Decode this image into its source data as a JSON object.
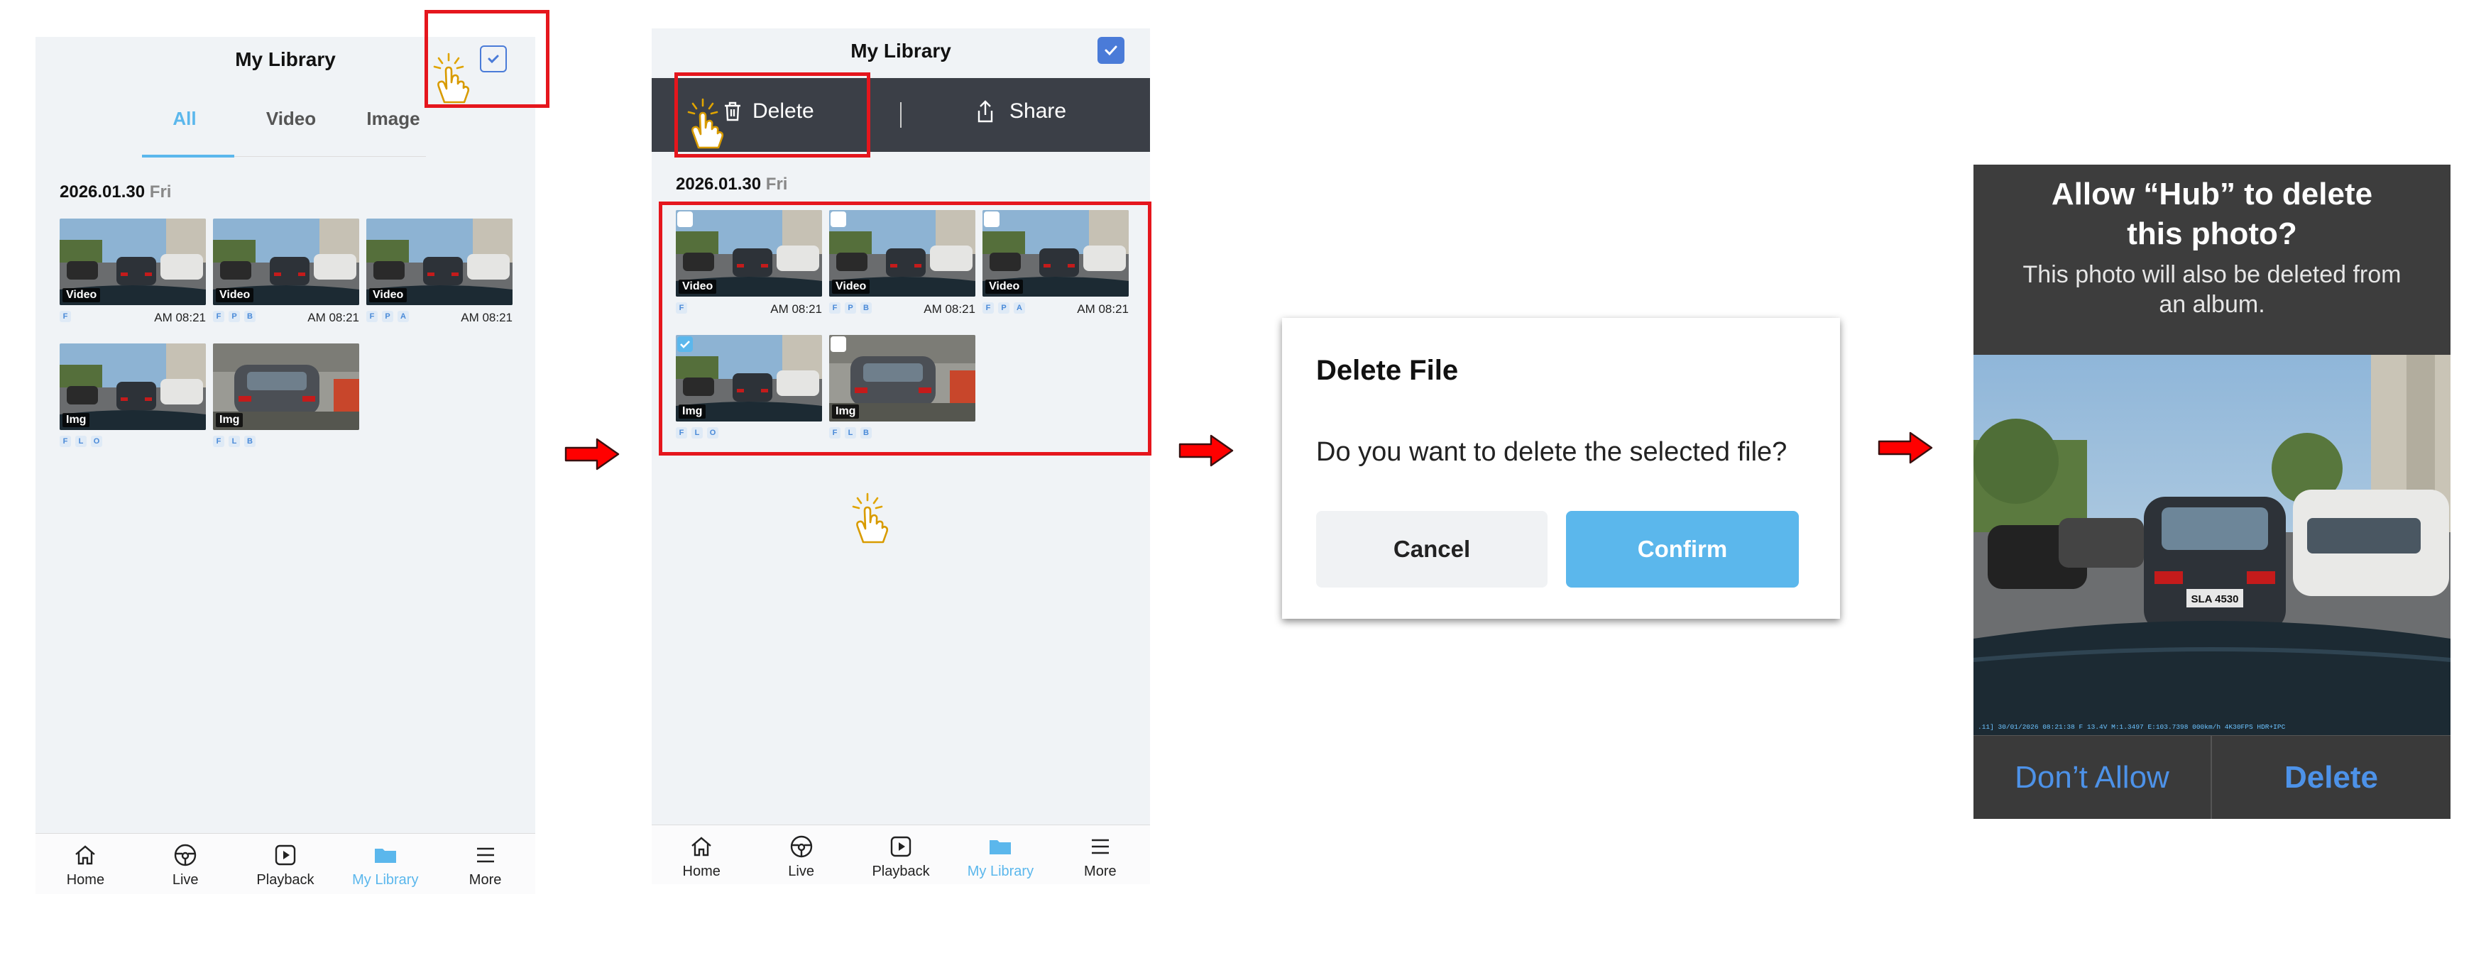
{
  "screen1": {
    "title": "My Library",
    "tabs": [
      {
        "label": "All",
        "active": true
      },
      {
        "label": "Video",
        "active": false
      },
      {
        "label": "Image",
        "active": false
      }
    ],
    "date": "2026.01.30",
    "weekday": "Fri",
    "files": [
      {
        "tag": "Video",
        "badges": [
          "F"
        ],
        "time": "AM 08:21"
      },
      {
        "tag": "Video",
        "badges": [
          "F",
          "P",
          "B"
        ],
        "time": "AM 08:21"
      },
      {
        "tag": "Video",
        "badges": [
          "F",
          "P",
          "A"
        ],
        "time": "AM 08:21"
      },
      {
        "tag": "Img",
        "badges": [
          "F",
          "L",
          "O"
        ],
        "time": ""
      },
      {
        "tag": "Img",
        "badges": [
          "F",
          "L",
          "B"
        ],
        "time": ""
      }
    ]
  },
  "screen2": {
    "title": "My Library",
    "delete_label": "Delete",
    "share_label": "Share",
    "date": "2026.01.30",
    "weekday": "Fri",
    "files": [
      {
        "tag": "Video",
        "badges": [
          "F"
        ],
        "time": "AM 08:21",
        "checked": false
      },
      {
        "tag": "Video",
        "badges": [
          "F",
          "P",
          "B"
        ],
        "time": "AM 08:21",
        "checked": false
      },
      {
        "tag": "Video",
        "badges": [
          "F",
          "P",
          "A"
        ],
        "time": "AM 08:21",
        "checked": false
      },
      {
        "tag": "Img",
        "badges": [
          "F",
          "L",
          "O"
        ],
        "time": "",
        "checked": true
      },
      {
        "tag": "Img",
        "badges": [
          "F",
          "L",
          "B"
        ],
        "time": "",
        "checked": false
      }
    ]
  },
  "nav": [
    {
      "label": "Home",
      "icon": "home-icon"
    },
    {
      "label": "Live",
      "icon": "steering-wheel-icon"
    },
    {
      "label": "Playback",
      "icon": "play-icon"
    },
    {
      "label": "My Library",
      "icon": "folder-icon",
      "active": true
    },
    {
      "label": "More",
      "icon": "menu-icon"
    }
  ],
  "dialog": {
    "title": "Delete File",
    "message": "Do you want to delete the selected file?",
    "cancel_label": "Cancel",
    "confirm_label": "Confirm"
  },
  "ios_alert": {
    "title_line1": "Allow “Hub” to delete",
    "title_line2": "this photo?",
    "message_line1": "This photo will also be deleted from",
    "message_line2": "an album.",
    "dont_allow_label": "Don’t Allow",
    "delete_label": "Delete",
    "plate": "SLA 4530",
    "overlay_text": ".11] 30/01/2026 08:21:38 F 13.4V M:1.3497 E:103.7398 000km/h 4K30FPS HDR+IPC"
  },
  "colors": {
    "accent": "#5bb7ec",
    "checkbox": "#4a7bd8",
    "highlight_red": "#e5161d",
    "arrow_red": "#ff0000",
    "hand": "#e0a400",
    "action_bar": "#3b3f47"
  }
}
